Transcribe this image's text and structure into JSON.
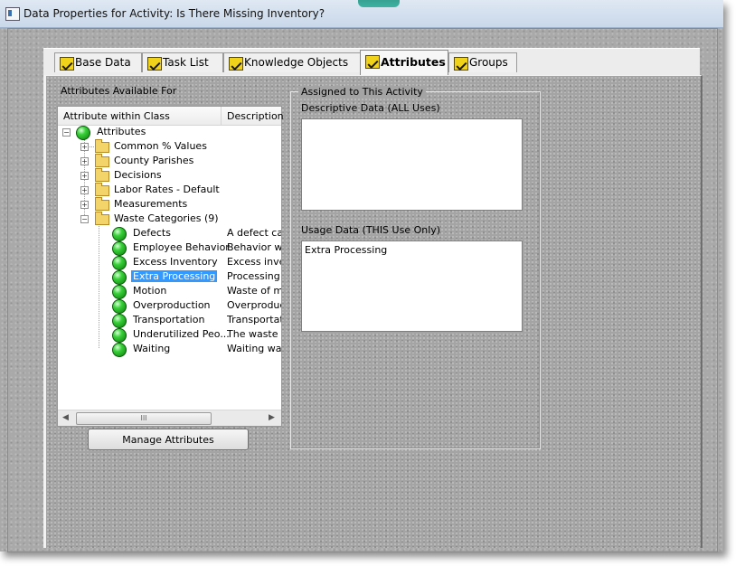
{
  "window": {
    "title": "Data Properties for Activity: Is There Missing Inventory?"
  },
  "tabs": [
    {
      "label": "Base Data",
      "active": false
    },
    {
      "label": "Task List",
      "active": false
    },
    {
      "label": "Knowledge Objects",
      "active": false
    },
    {
      "label": "Attributes",
      "active": true
    },
    {
      "label": "Groups",
      "active": false
    }
  ],
  "left": {
    "section_label": "Attributes Available For",
    "columns": [
      "Attribute within Class",
      "Description"
    ],
    "root": "Attributes",
    "folders": [
      {
        "label": "Common % Values",
        "expanded": false
      },
      {
        "label": "County Parishes",
        "expanded": false
      },
      {
        "label": "Decisions",
        "expanded": false
      },
      {
        "label": "Labor Rates - Default",
        "expanded": false
      },
      {
        "label": "Measurements",
        "expanded": false
      },
      {
        "label": "Waste Categories (9)",
        "expanded": true
      }
    ],
    "waste_items": [
      {
        "name": "Defects",
        "desc": "A defect ca."
      },
      {
        "name": "Employee Behavior",
        "desc": "Behavior wa"
      },
      {
        "name": "Excess Inventory",
        "desc": "Excess inve"
      },
      {
        "name": "Extra Processing",
        "desc": "Processing .",
        "selected": true
      },
      {
        "name": "Motion",
        "desc": "Waste of mo"
      },
      {
        "name": "Overproduction",
        "desc": "Overproduct"
      },
      {
        "name": "Transportation",
        "desc": "Transportati."
      },
      {
        "name": "Underutilized Peo...",
        "desc": "The waste o"
      },
      {
        "name": "Waiting",
        "desc": "Waiting was"
      }
    ],
    "scroll_thumb_label": "III",
    "manage_button": "Manage Attributes"
  },
  "right": {
    "group_title": "Assigned to This Activity",
    "descriptive_label": "Descriptive Data (ALL Uses)",
    "descriptive_value": "",
    "usage_label": "Usage Data (THIS Use Only)",
    "usage_value": "Extra Processing"
  }
}
